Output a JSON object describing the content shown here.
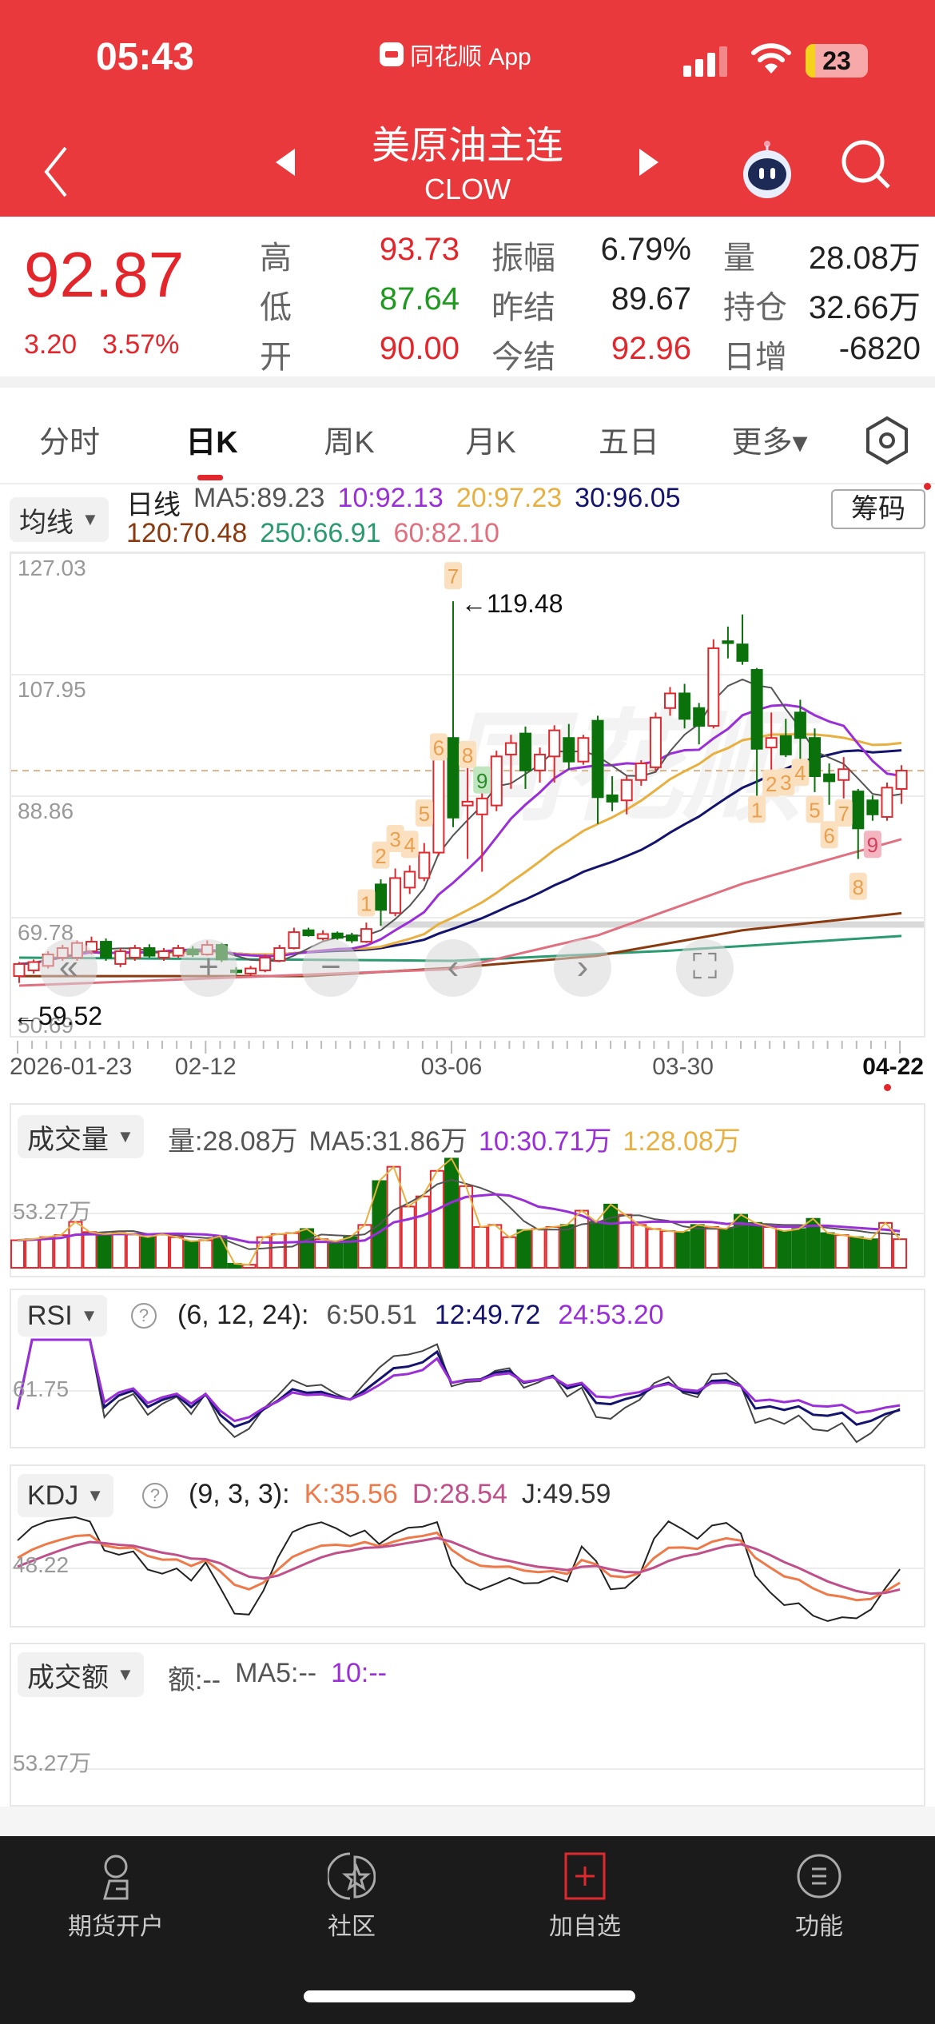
{
  "status_bar": {
    "time": "05:43",
    "app_name": "同花顺 App",
    "battery": "23"
  },
  "nav": {
    "title": "美原油主连",
    "code": "CLOW"
  },
  "quote": {
    "price": "92.87",
    "change": "3.20",
    "change_pct": "3.57%",
    "rows": [
      [
        {
          "label": "高",
          "value": "93.73",
          "color": "#e3262b"
        },
        {
          "label": "振幅",
          "value": "6.79%",
          "color": "#222"
        },
        {
          "label": "量",
          "value": "28.08万",
          "color": "#222"
        }
      ],
      [
        {
          "label": "低",
          "value": "87.64",
          "color": "#1f9a1f"
        },
        {
          "label": "昨结",
          "value": "89.67",
          "color": "#222"
        },
        {
          "label": "持仓",
          "value": "32.66万",
          "color": "#222"
        }
      ],
      [
        {
          "label": "开",
          "value": "90.00",
          "color": "#e3262b"
        },
        {
          "label": "今结",
          "value": "92.96",
          "color": "#e3262b"
        },
        {
          "label": "日增",
          "value": "-6820",
          "color": "#222"
        }
      ]
    ]
  },
  "tabs": [
    "分时",
    "日K",
    "周K",
    "月K",
    "五日",
    "更多▾"
  ],
  "active_tab": "日K",
  "ma_legend": {
    "selector": "均线",
    "chip_button": "筹码",
    "row1": [
      {
        "t": "日线",
        "c": "#222"
      },
      {
        "t": "MA5:89.23",
        "c": "#555"
      },
      {
        "t": "10:92.13",
        "c": "#9a2fd8"
      },
      {
        "t": "20:97.23",
        "c": "#e8b040"
      },
      {
        "t": "30:96.05",
        "c": "#14146e"
      }
    ],
    "row2": [
      {
        "t": "120:70.48",
        "c": "#8b3a10"
      },
      {
        "t": "250:66.91",
        "c": "#2a9a70"
      },
      {
        "t": "60:82.10",
        "c": "#e07080"
      }
    ]
  },
  "colors": {
    "up": "#e0282e",
    "down": "#0b720b",
    "ma5": "#555555",
    "ma10": "#9a2fd8",
    "ma20": "#e8b040",
    "ma30": "#14146e",
    "ma60": "#e07080",
    "ma120": "#8b3a10",
    "ma250": "#2a9a70"
  },
  "chart_data": {
    "type": "candlestick",
    "ylim": [
      50.69,
      127.03
    ],
    "y_ticks": [
      "127.03",
      "107.95",
      "88.86",
      "69.78",
      "50.69"
    ],
    "x_labels": [
      {
        "i": 0,
        "t": "2026-01-23"
      },
      {
        "i": 13,
        "t": "02-12"
      },
      {
        "i": 30,
        "t": "03-06"
      },
      {
        "i": 46,
        "t": "03-30"
      },
      {
        "i": 61,
        "t": "04-22"
      }
    ],
    "high_note": {
      "i": 30,
      "price": 119.48,
      "text": "←119.48"
    },
    "low_note": {
      "i": 0,
      "price": 59.52,
      "text": "←59.52"
    },
    "last_price": 92.87,
    "ohlc": [
      [
        60.6,
        62.8,
        59.52,
        62.5
      ],
      [
        61.5,
        63.2,
        61,
        62.8
      ],
      [
        62.2,
        64.5,
        61.8,
        64
      ],
      [
        63.5,
        65.5,
        63,
        65
      ],
      [
        63.5,
        66.2,
        63,
        65.8
      ],
      [
        64.5,
        66.8,
        64,
        66
      ],
      [
        66,
        66.5,
        63,
        63.5
      ],
      [
        62.5,
        65,
        62,
        64.5
      ],
      [
        63.5,
        65.5,
        63,
        65
      ],
      [
        65,
        65.6,
        63.5,
        63.8
      ],
      [
        63.5,
        65,
        63,
        64.5
      ],
      [
        63.8,
        65.5,
        63.5,
        65
      ],
      [
        64.8,
        65.3,
        63.6,
        64
      ],
      [
        64,
        66.2,
        63.8,
        65.5
      ],
      [
        65.5,
        65.8,
        62.8,
        63.2
      ],
      [
        61.5,
        62,
        60.8,
        61.2
      ],
      [
        61,
        62.2,
        60.6,
        61.8
      ],
      [
        61.5,
        64,
        61.2,
        63.5
      ],
      [
        63,
        65.5,
        62.8,
        65
      ],
      [
        65,
        68.2,
        64.8,
        67.5
      ],
      [
        67.8,
        68.2,
        66.8,
        67
      ],
      [
        66.5,
        67.8,
        66.2,
        67.2
      ],
      [
        67.3,
        67.6,
        66.3,
        66.6
      ],
      [
        67,
        67.4,
        65.8,
        66.2
      ],
      [
        66,
        69,
        65.8,
        68
      ],
      [
        75,
        75.8,
        68.5,
        71
      ],
      [
        70.5,
        77.5,
        70,
        76
      ],
      [
        74.5,
        78,
        73.5,
        77
      ],
      [
        76,
        81.5,
        75.5,
        80
      ],
      [
        80,
        96,
        79.5,
        95
      ],
      [
        98,
        119.48,
        84,
        85.5
      ],
      [
        87.4,
        97,
        79,
        88
      ],
      [
        86,
        92,
        77,
        88.5
      ],
      [
        87.4,
        96,
        86.5,
        95.1
      ],
      [
        95.4,
        98.5,
        90,
        97.2
      ],
      [
        98.7,
        99.8,
        90,
        92.9
      ],
      [
        92.9,
        96.5,
        91,
        95.4
      ],
      [
        95.1,
        100,
        91,
        99.2
      ],
      [
        98,
        100.2,
        93,
        94.3
      ],
      [
        94.3,
        98.5,
        93.8,
        98
      ],
      [
        100.7,
        101.5,
        84.5,
        88.7
      ],
      [
        89,
        92,
        86.5,
        88
      ],
      [
        88.2,
        92,
        86,
        91.4
      ],
      [
        91.4,
        94.5,
        90.5,
        94
      ],
      [
        93.4,
        102,
        92.8,
        101.2
      ],
      [
        102.7,
        106,
        101.5,
        105
      ],
      [
        105,
        106.5,
        99.5,
        101
      ],
      [
        102.7,
        103.5,
        97,
        99.9
      ],
      [
        99.9,
        113.5,
        99.5,
        112.1
      ],
      [
        113.2,
        115.5,
        110.5,
        112.9
      ],
      [
        112.7,
        117.4,
        109.5,
        110.1
      ],
      [
        108.7,
        109,
        88,
        96.3
      ],
      [
        96.5,
        102,
        93,
        98
      ],
      [
        98.3,
        101,
        95,
        95.4
      ],
      [
        102,
        104,
        94,
        98
      ],
      [
        98,
        99.5,
        89.5,
        92
      ],
      [
        92.3,
        94,
        87.5,
        91.2
      ],
      [
        91.4,
        95,
        88.5,
        93.1
      ],
      [
        89.6,
        90,
        79,
        83.8
      ],
      [
        88.2,
        89,
        85,
        86
      ],
      [
        85.6,
        91,
        85,
        90.2
      ],
      [
        90,
        93.73,
        87.64,
        92.87
      ]
    ],
    "long_ma": {
      "ma60": [
        [
          0,
          59.1
        ],
        [
          30,
          61.7
        ],
        [
          40,
          67
        ],
        [
          50,
          75.1
        ],
        [
          61,
          82.1
        ]
      ],
      "ma120": [
        [
          0,
          60.6
        ],
        [
          20,
          60.6
        ],
        [
          30,
          61.9
        ],
        [
          40,
          63.8
        ],
        [
          50,
          67.8
        ],
        [
          61,
          70.48
        ]
      ],
      "ma250": [
        [
          0,
          63.5
        ],
        [
          30,
          63
        ],
        [
          45,
          64.6
        ],
        [
          61,
          66.91
        ]
      ]
    },
    "markers": [
      {
        "i": 24,
        "price": 72.1,
        "t": "1"
      },
      {
        "i": 25,
        "price": 79.6,
        "t": "2"
      },
      {
        "i": 26,
        "price": 82.2,
        "t": "3"
      },
      {
        "i": 27,
        "price": 81.3,
        "t": "4"
      },
      {
        "i": 28,
        "price": 86.2,
        "t": "5"
      },
      {
        "i": 29,
        "price": 96.6,
        "t": "6"
      },
      {
        "i": 30,
        "price": 123.5,
        "t": "7"
      },
      {
        "i": 31,
        "price": 95.4,
        "t": "8"
      },
      {
        "i": 32,
        "price": 91.4,
        "t": "9",
        "kind": "green"
      },
      {
        "i": 51,
        "price": 86.8,
        "t": "1"
      },
      {
        "i": 52,
        "price": 90.9,
        "t": "2"
      },
      {
        "i": 53,
        "price": 91.1,
        "t": "3"
      },
      {
        "i": 54,
        "price": 92.6,
        "t": "4"
      },
      {
        "i": 55,
        "price": 86.8,
        "t": "5"
      },
      {
        "i": 56,
        "price": 82.8,
        "t": "6"
      },
      {
        "i": 57,
        "price": 86.2,
        "t": "7"
      },
      {
        "i": 58,
        "price": 74.7,
        "t": "8"
      },
      {
        "i": 59,
        "price": 81.3,
        "t": "9",
        "kind": "pink"
      }
    ],
    "volume": [
      27,
      28,
      30,
      32,
      45,
      35,
      33,
      34,
      33,
      30,
      33,
      30,
      26,
      27,
      31,
      4,
      3,
      30,
      33,
      34,
      38,
      28,
      26,
      30,
      42,
      85,
      99,
      60,
      70,
      95,
      107,
      80,
      40,
      42,
      30,
      37,
      38,
      40,
      42,
      56,
      45,
      62,
      52,
      42,
      38,
      36,
      35,
      42,
      40,
      38,
      52,
      44,
      40,
      36,
      38,
      48,
      34,
      32,
      30,
      28,
      44,
      28.08
    ],
    "volume_ref": 53.27
  },
  "volume_panel": {
    "selector": "成交量",
    "legend": [
      {
        "t": "量:28.08万",
        "c": "#555"
      },
      {
        "t": "MA5:31.86万",
        "c": "#555"
      },
      {
        "t": "10:30.71万",
        "c": "#9a2fd8"
      },
      {
        "t": "1:28.08万",
        "c": "#e8b040"
      }
    ],
    "axis": "53.27万"
  },
  "rsi_panel": {
    "selector": "RSI",
    "params": "(6, 12, 24):",
    "legend": [
      {
        "t": "6:50.51",
        "c": "#555"
      },
      {
        "t": "12:49.72",
        "c": "#14146e"
      },
      {
        "t": "24:53.20",
        "c": "#9a2fd8"
      }
    ],
    "axis": "61.75"
  },
  "kdj_panel": {
    "selector": "KDJ",
    "params": "(9, 3, 3):",
    "legend": [
      {
        "t": "K:35.56",
        "c": "#ee7a4a"
      },
      {
        "t": "D:28.54",
        "c": "#c0508a"
      },
      {
        "t": "J:49.59",
        "c": "#333"
      }
    ],
    "axis": "48.22"
  },
  "amount_panel": {
    "selector": "成交额",
    "legend": [
      {
        "t": "额:--",
        "c": "#555"
      },
      {
        "t": "MA5:--",
        "c": "#555"
      },
      {
        "t": "10:--",
        "c": "#9a2fd8"
      }
    ],
    "axis": "53.27万"
  },
  "tabbar": [
    {
      "label": "期货开户",
      "icon": "account-icon"
    },
    {
      "label": "社区",
      "icon": "community-icon"
    },
    {
      "label": "加自选",
      "icon": "add-watchlist-icon"
    },
    {
      "label": "功能",
      "icon": "menu-icon"
    }
  ]
}
